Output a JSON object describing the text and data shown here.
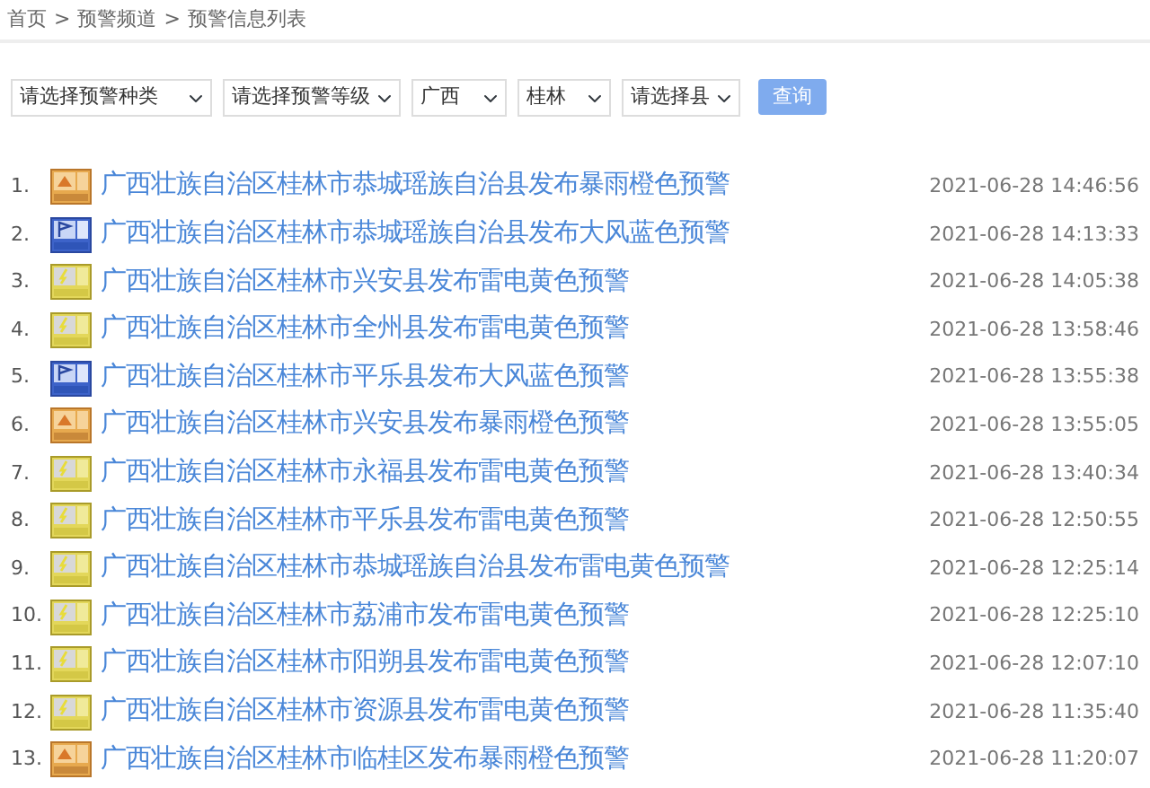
{
  "breadcrumb": [
    "首页",
    ">",
    "预警频道",
    ">",
    "预警信息列表"
  ],
  "filters": [
    {
      "value": "请选择预警种类"
    },
    {
      "value": "请选择预警等级"
    },
    {
      "value": "广西"
    },
    {
      "value": "桂林"
    },
    {
      "value": "请选择县"
    }
  ],
  "query_button": "查询",
  "warnings": [
    {
      "number": "1.",
      "kind": "rain",
      "title": "广西壮族自治区桂林市恭城瑶族自治县发布暴雨橙色预警",
      "time": "2021-06-28 14:46:56"
    },
    {
      "number": "2.",
      "kind": "wind",
      "title": "广西壮族自治区桂林市恭城瑶族自治县发布大风蓝色预警",
      "time": "2021-06-28 14:13:33"
    },
    {
      "number": "3.",
      "kind": "thunder",
      "title": "广西壮族自治区桂林市兴安县发布雷电黄色预警",
      "time": "2021-06-28 14:05:38"
    },
    {
      "number": "4.",
      "kind": "thunder",
      "title": "广西壮族自治区桂林市全州县发布雷电黄色预警",
      "time": "2021-06-28 13:58:46"
    },
    {
      "number": "5.",
      "kind": "wind",
      "title": "广西壮族自治区桂林市平乐县发布大风蓝色预警",
      "time": "2021-06-28 13:55:38"
    },
    {
      "number": "6.",
      "kind": "rain",
      "title": "广西壮族自治区桂林市兴安县发布暴雨橙色预警",
      "time": "2021-06-28 13:55:05"
    },
    {
      "number": "7.",
      "kind": "thunder",
      "title": "广西壮族自治区桂林市永福县发布雷电黄色预警",
      "time": "2021-06-28 13:40:34"
    },
    {
      "number": "8.",
      "kind": "thunder",
      "title": "广西壮族自治区桂林市平乐县发布雷电黄色预警",
      "time": "2021-06-28 12:50:55"
    },
    {
      "number": "9.",
      "kind": "thunder",
      "title": "广西壮族自治区桂林市恭城瑶族自治县发布雷电黄色预警",
      "time": "2021-06-28 12:25:14"
    },
    {
      "number": "10.",
      "kind": "thunder",
      "title": "广西壮族自治区桂林市荔浦市发布雷电黄色预警",
      "time": "2021-06-28 12:25:10"
    },
    {
      "number": "11.",
      "kind": "thunder",
      "title": "广西壮族自治区桂林市阳朔县发布雷电黄色预警",
      "time": "2021-06-28 12:07:10"
    },
    {
      "number": "12.",
      "kind": "thunder",
      "title": "广西壮族自治区桂林市资源县发布雷电黄色预警",
      "time": "2021-06-28 11:35:40"
    },
    {
      "number": "13.",
      "kind": "rain",
      "title": "广西壮族自治区桂林市临桂区发布暴雨橙色预警",
      "time": "2021-06-28 11:20:07"
    }
  ]
}
